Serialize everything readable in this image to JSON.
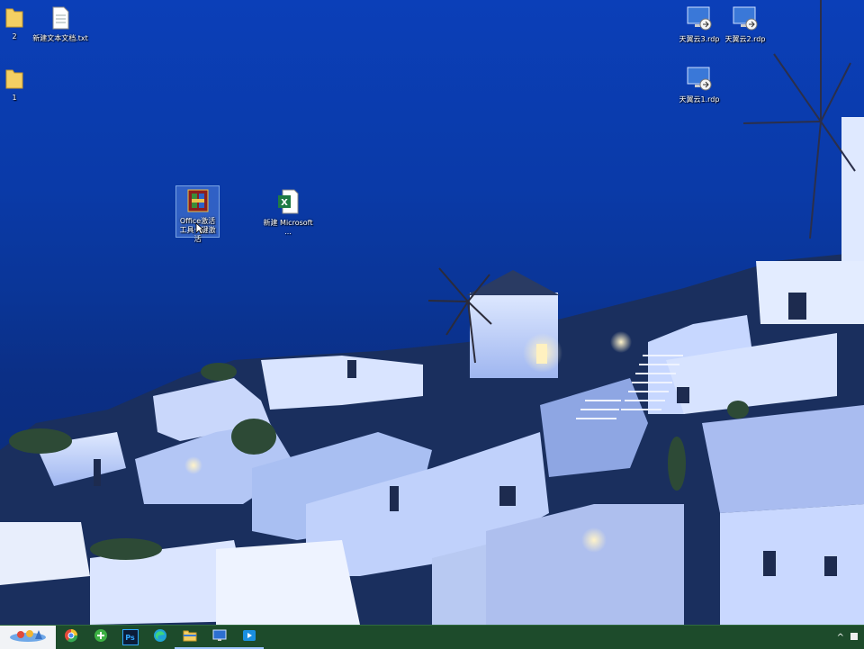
{
  "desktop": {
    "icons": [
      {
        "id": "folder-2",
        "label": "2",
        "type": "folder"
      },
      {
        "id": "txt-file",
        "label": "新建文本文档.txt",
        "type": "text-file"
      },
      {
        "id": "folder-1",
        "label": "1",
        "type": "folder"
      },
      {
        "id": "office-activator",
        "label": "Office激活工具一键激活",
        "type": "app",
        "selected": true
      },
      {
        "id": "excel-file",
        "label": "新建 Microsoft ...",
        "type": "excel"
      },
      {
        "id": "rdp-3",
        "label": "天翼云3.rdp",
        "type": "rdp"
      },
      {
        "id": "rdp-2",
        "label": "天翼云2.rdp",
        "type": "rdp"
      },
      {
        "id": "rdp-1",
        "label": "天翼云1.rdp",
        "type": "rdp"
      }
    ]
  },
  "taskbar": {
    "start_icon": "start-logo-icon",
    "apps": [
      {
        "name": "browser-icon"
      },
      {
        "name": "green-app-icon"
      },
      {
        "name": "photoshop-icon",
        "text": "Ps"
      },
      {
        "name": "edge-icon"
      },
      {
        "name": "file-explorer-icon"
      },
      {
        "name": "remote-desktop-icon"
      },
      {
        "name": "video-app-icon"
      }
    ],
    "tray": {
      "chevron": "^"
    }
  }
}
